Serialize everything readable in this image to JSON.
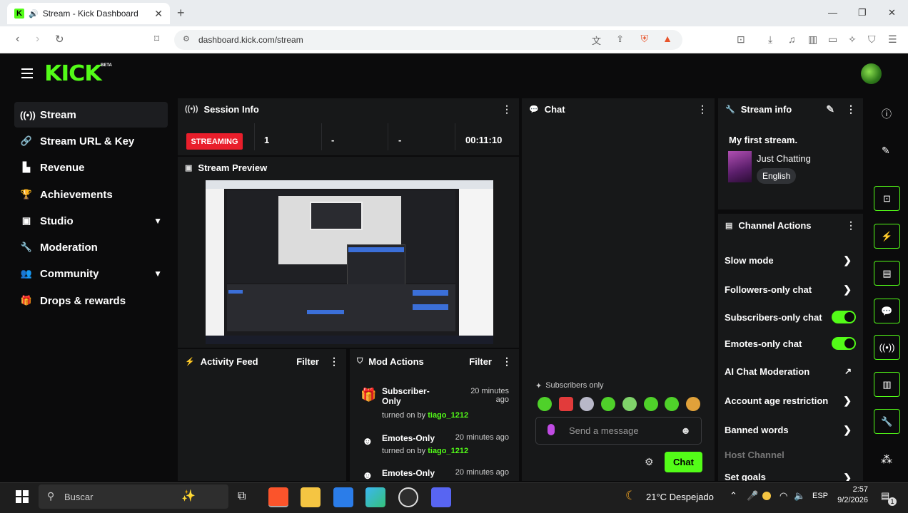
{
  "browser": {
    "tab_title": "Stream - Kick Dashboard",
    "new_tab": "+",
    "url": "dashboard.kick.com/stream"
  },
  "header": {
    "logo": "KICK",
    "beta": "BETA"
  },
  "sidebar": {
    "items": [
      {
        "label": "Stream",
        "icon": "broadcast-icon"
      },
      {
        "label": "Stream URL & Key",
        "icon": "link-icon"
      },
      {
        "label": "Revenue",
        "icon": "chart-icon"
      },
      {
        "label": "Achievements",
        "icon": "trophy-icon"
      },
      {
        "label": "Studio",
        "icon": "monitor-icon"
      },
      {
        "label": "Moderation",
        "icon": "wrench-icon"
      },
      {
        "label": "Community",
        "icon": "people-icon"
      },
      {
        "label": "Drops & rewards",
        "icon": "gift-icon"
      }
    ]
  },
  "session": {
    "title": "Session Info",
    "status": "STREAMING",
    "viewers": "1",
    "stat2": "-",
    "stat3": "-",
    "duration": "00:11:10"
  },
  "preview": {
    "title": "Stream Preview"
  },
  "activity": {
    "title": "Activity Feed",
    "filter": "Filter"
  },
  "mod_actions": {
    "title": "Mod Actions",
    "filter": "Filter",
    "items": [
      {
        "action": "Subscriber-Only",
        "action_l1": "Subscriber-",
        "action_l2": "Only",
        "time_l1": "20 minutes",
        "time_l2": "ago",
        "prefix": "turned on by",
        "user": "tiago_1212"
      },
      {
        "action": "Emotes-Only",
        "time": "20 minutes ago",
        "prefix": "turned on by",
        "user": "tiago_1212"
      },
      {
        "action": "Emotes-Only",
        "time": "20 minutes ago"
      }
    ]
  },
  "chat": {
    "title": "Chat",
    "mode_notice": "Subscribers only",
    "placeholder": "Send a message",
    "send_label": "Chat"
  },
  "stream_info": {
    "title": "Stream info",
    "stream_title": "My first stream.",
    "category": "Just Chatting",
    "language": "English"
  },
  "channel_actions": {
    "title": "Channel Actions",
    "items": [
      {
        "label": "Slow mode",
        "control": "arrow"
      },
      {
        "label": "Followers-only chat",
        "control": "arrow"
      },
      {
        "label": "Subscribers-only chat",
        "control": "toggle",
        "on": true
      },
      {
        "label": "Emotes-only chat",
        "control": "toggle",
        "on": true
      },
      {
        "label": "AI Chat Moderation",
        "control": "external"
      },
      {
        "label": "Account age restriction",
        "control": "arrow"
      },
      {
        "label": "Banned words",
        "control": "arrow"
      },
      {
        "label": "Host Channel",
        "control": "none",
        "disabled": true
      },
      {
        "label": "Set goals",
        "control": "arrow"
      }
    ]
  },
  "taskbar": {
    "search_placeholder": "Buscar",
    "weather": "21°C  Despejado",
    "lang": "ESP",
    "time": "2:57",
    "date": "9/2/2026",
    "notif_count": "1"
  },
  "colors": {
    "accent": "#53fc18",
    "live": "#e91e2b",
    "bg": "#0b0b0c",
    "panel": "#171819"
  }
}
